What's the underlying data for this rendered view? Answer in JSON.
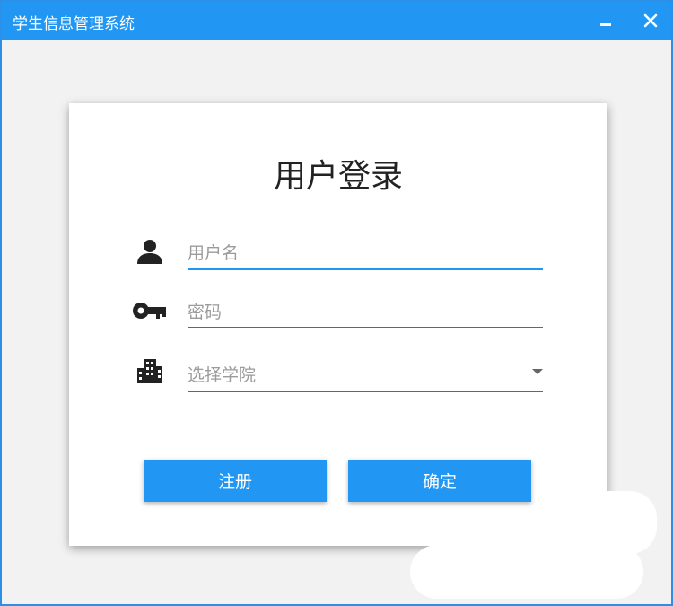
{
  "window": {
    "title": "学生信息管理系统",
    "minimize_icon": "minimize-icon",
    "close_icon": "close-icon"
  },
  "login": {
    "heading": "用户登录",
    "username": {
      "icon": "user-icon",
      "value": "",
      "placeholder": "用户名"
    },
    "password": {
      "icon": "key-icon",
      "value": "",
      "placeholder": "密码"
    },
    "college": {
      "icon": "building-icon",
      "selected": "选择学院",
      "caret_icon": "dropdown-caret-icon"
    },
    "register_label": "注册",
    "confirm_label": "确定"
  },
  "colors": {
    "accent": "#2196f3",
    "title_bar": "#2196f3",
    "window_bg": "#f2f2f2",
    "card_bg": "#ffffff"
  }
}
